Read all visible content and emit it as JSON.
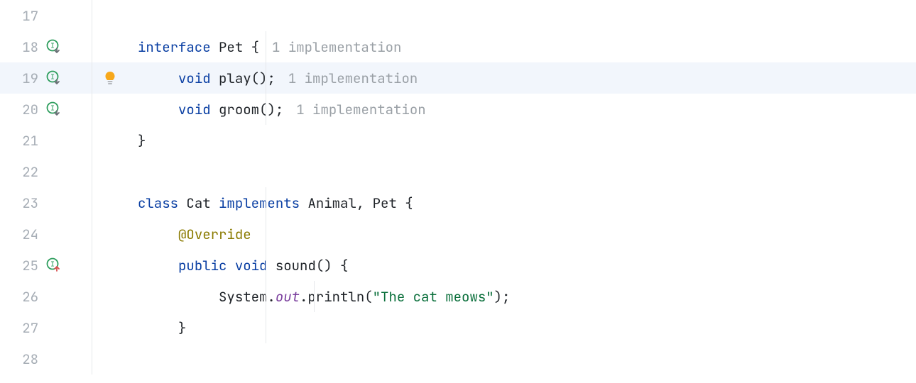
{
  "lines": {
    "17": {
      "num": "17"
    },
    "18": {
      "num": "18",
      "kw_interface": "interface",
      "name": "Pet",
      "brace": " {",
      "inlay": "1 implementation"
    },
    "19": {
      "num": "19",
      "kw_void": "void",
      "name": "play",
      "after": "();",
      "inlay": "1 implementation"
    },
    "20": {
      "num": "20",
      "kw_void": "void",
      "name": "groom",
      "after": "();",
      "inlay": "1 implementation"
    },
    "21": {
      "num": "21",
      "brace": "}"
    },
    "22": {
      "num": "22"
    },
    "23": {
      "num": "23",
      "kw_class": "class",
      "name": "Cat",
      "kw_implements": "implements",
      "impls": "Animal, Pet",
      "brace": " {"
    },
    "24": {
      "num": "24",
      "ann": "@Override"
    },
    "25": {
      "num": "25",
      "kw_public": "public",
      "kw_void": "void",
      "name": "sound",
      "after": "() {"
    },
    "26": {
      "num": "26",
      "sys": "System.",
      "out": "out",
      "println": ".println(",
      "str": "\"The cat meows\"",
      "end": ");"
    },
    "27": {
      "num": "27",
      "brace": "}"
    },
    "28": {
      "num": "28"
    }
  }
}
